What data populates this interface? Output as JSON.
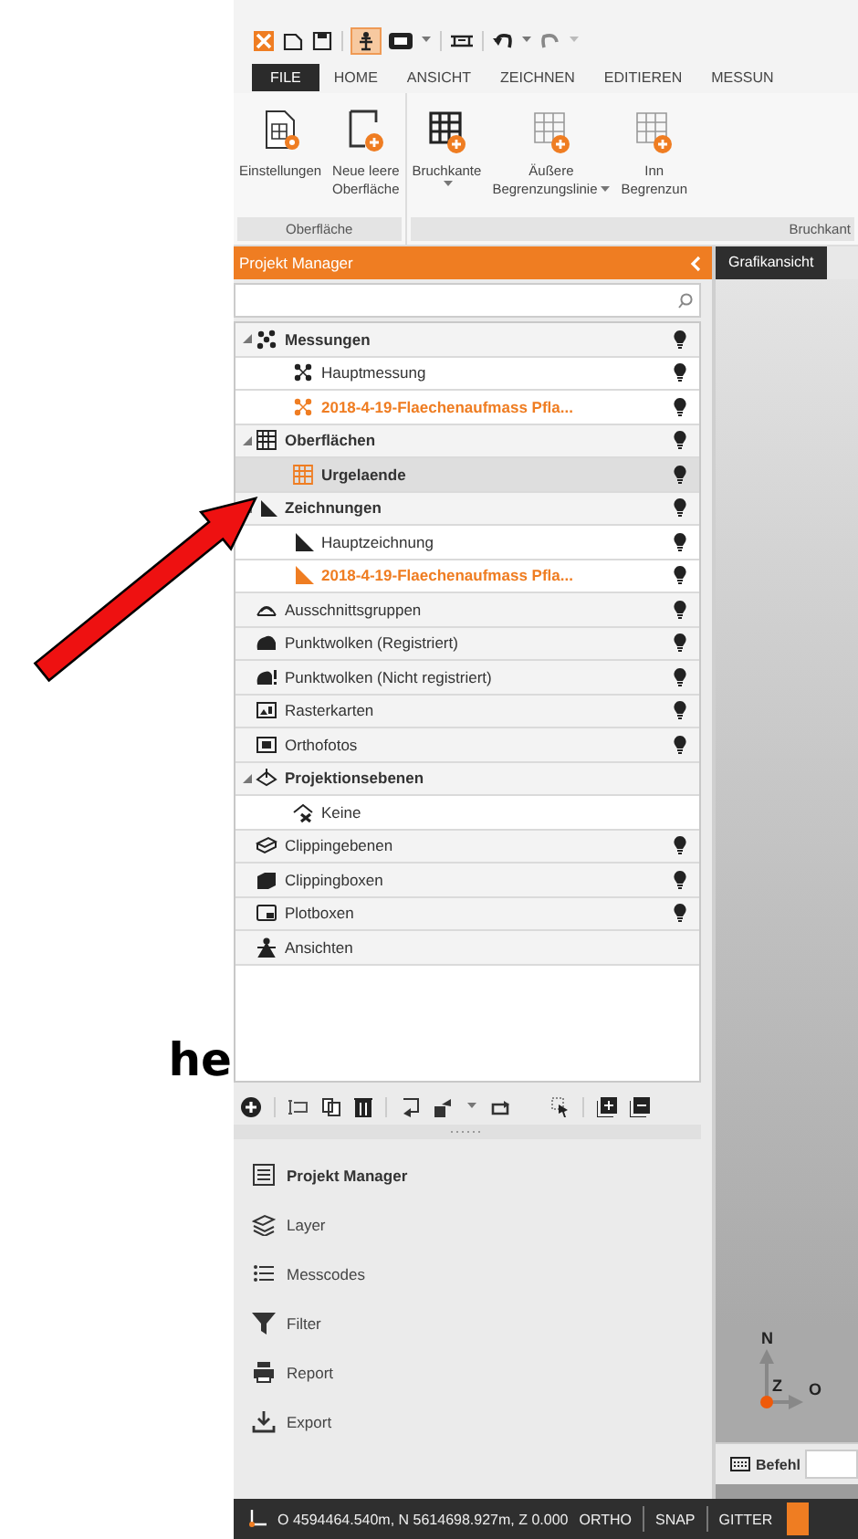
{
  "annotation": {
    "text": "he"
  },
  "quick_access": {
    "toggle_on": true
  },
  "tabs": [
    {
      "label": "FILE",
      "kind": "file"
    },
    {
      "label": "HOME",
      "kind": "tab"
    },
    {
      "label": "ANSICHT",
      "kind": "tab"
    },
    {
      "label": "ZEICHNEN",
      "kind": "tab"
    },
    {
      "label": "EDITIEREN",
      "kind": "tab"
    },
    {
      "label": "MESSUN",
      "kind": "tab"
    }
  ],
  "ribbon": [
    {
      "label": "Oberfläche",
      "buttons": [
        {
          "lines": [
            "Einstellungen"
          ],
          "dropdown": false
        },
        {
          "lines": [
            "Neue leere",
            "Oberfläche"
          ],
          "dropdown": false
        }
      ]
    },
    {
      "label": "Bruchkant",
      "buttons": [
        {
          "lines": [
            "Bruchkante"
          ],
          "dropdown": true
        },
        {
          "lines": [
            "Äußere",
            "Begrenzungslinie"
          ],
          "dropdown": true
        },
        {
          "lines": [
            "Inn",
            "Begrenzun"
          ],
          "dropdown": false
        }
      ]
    }
  ],
  "panel": {
    "title": "Projekt Manager"
  },
  "tree": [
    {
      "label": "Messungen",
      "bulb": true,
      "expanded": true,
      "children": [
        {
          "label": "Hauptmessung",
          "bulb": true
        },
        {
          "label": "2018-4-19-Flaechenaufmass Pfla...",
          "bulb": true,
          "highlighted": true
        }
      ]
    },
    {
      "label": "Oberflächen",
      "bulb": true,
      "expanded": true,
      "children": [
        {
          "label": "Urgelaende",
          "bulb": true,
          "selected": true
        }
      ]
    },
    {
      "label": "Zeichnungen",
      "bulb": true,
      "expanded": true,
      "children": [
        {
          "label": "Hauptzeichnung",
          "bulb": true
        },
        {
          "label": "2018-4-19-Flaechenaufmass Pfla...",
          "bulb": true,
          "highlighted": true
        }
      ]
    },
    {
      "label": "Ausschnittsgruppen",
      "bulb": true
    },
    {
      "label": "Punktwolken (Registriert)",
      "bulb": true
    },
    {
      "label": "Punktwolken (Nicht registriert)",
      "bulb": true
    },
    {
      "label": "Rasterkarten",
      "bulb": true
    },
    {
      "label": "Orthofotos",
      "bulb": true
    },
    {
      "label": "Projektionsebenen",
      "bulb": false,
      "expanded": true,
      "children": [
        {
          "label": "Keine",
          "bulb": false
        }
      ]
    },
    {
      "label": "Clippingebenen",
      "bulb": true
    },
    {
      "label": "Clippingboxen",
      "bulb": true
    },
    {
      "label": "Plotboxen",
      "bulb": true
    },
    {
      "label": "Ansichten",
      "bulb": false
    }
  ],
  "nav": [
    {
      "label": "Projekt Manager",
      "selected": true
    },
    {
      "label": "Layer",
      "selected": false
    },
    {
      "label": "Messcodes",
      "selected": false
    },
    {
      "label": "Filter",
      "selected": false
    },
    {
      "label": "Report",
      "selected": false
    },
    {
      "label": "Export",
      "selected": false
    }
  ],
  "viewport": {
    "tab": "Grafikansicht",
    "compass": {
      "north": "N",
      "up": "Z",
      "east": "O"
    },
    "command": {
      "label": "Befehl"
    }
  },
  "status_bar": {
    "coordinates": "O 4594464.540m, N 5614698.927m, Z 0.000",
    "toggles": [
      "ORTHO",
      "SNAP",
      "GITTER"
    ]
  }
}
